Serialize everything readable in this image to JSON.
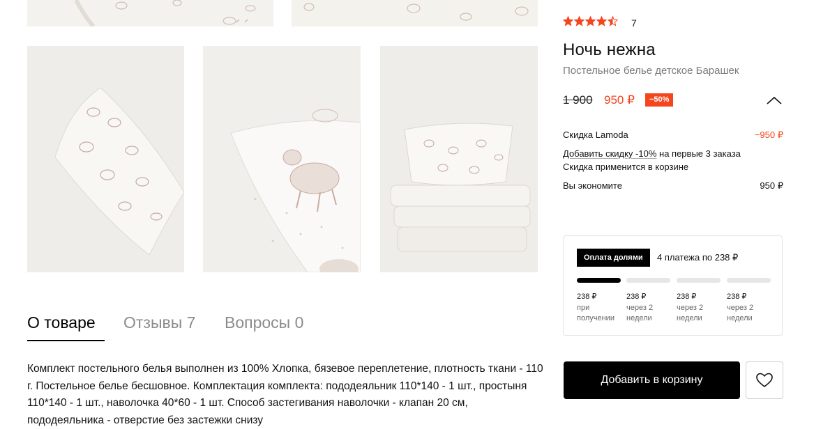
{
  "gallery": {
    "photos": [
      {
        "name": "photo-top-left-partial",
        "icon": "lamb-pattern-fabric"
      },
      {
        "name": "photo-top-right-partial",
        "icon": "lamb-pattern-fabric"
      },
      {
        "name": "photo-pillow-angled",
        "icon": "lamb-pattern-pillow"
      },
      {
        "name": "photo-pillow-closeup-lamb",
        "icon": "lamb-closeup"
      },
      {
        "name": "photo-bedding-stack",
        "icon": "folded-bedding-stack"
      }
    ]
  },
  "product": {
    "rating": 4.5,
    "stars_total": 5,
    "star_color": "#f5451d",
    "rating_count": "7",
    "brand": "Ночь нежна",
    "name": "Постельное белье детское Барашек",
    "price_old": "1 900",
    "price_new": "950 ₽",
    "discount_badge": "−50%",
    "accent_color": "#f5451d"
  },
  "price_details": {
    "lamoda_discount_label": "Скидка Lamoda",
    "lamoda_discount_value": "−950 ₽",
    "add_discount_link": "Добавить скидку -10%",
    "add_discount_rest": " на первые 3 заказа",
    "applied_note": "Скидка применится в корзине",
    "savings_label": "Вы экономите",
    "savings_value": "950 ₽"
  },
  "installments": {
    "badge": "Оплата долями",
    "summary": "4 платежа по 238 ₽",
    "paid_parts": 1,
    "payments": [
      {
        "amount": "238 ₽",
        "note": "при получении"
      },
      {
        "amount": "238 ₽",
        "note": "через 2 недели"
      },
      {
        "amount": "238 ₽",
        "note": "через 2 недели"
      },
      {
        "amount": "238 ₽",
        "note": "через 2 недели"
      }
    ]
  },
  "tabs": [
    {
      "label": "О товаре",
      "active": true
    },
    {
      "label": "Отзывы 7",
      "active": false
    },
    {
      "label": "Вопросы 0",
      "active": false
    }
  ],
  "description": "Комплект постельного белья выполнен из 100% Хлопка, бязевое переплетение, плотность ткани - 110 г. Постельное белье бесшовное. Комплектация комплекта: пододеяльник 110*140 - 1 шт., простыня 110*140 - 1 шт., наволочка 40*60 - 1 шт. Способ застегивания наволочки - клапан 20 см, пододеяльника - отверстие без застежки снизу",
  "actions": {
    "add_to_cart": "Добавить в корзину",
    "favorite_icon": "heart-icon"
  }
}
